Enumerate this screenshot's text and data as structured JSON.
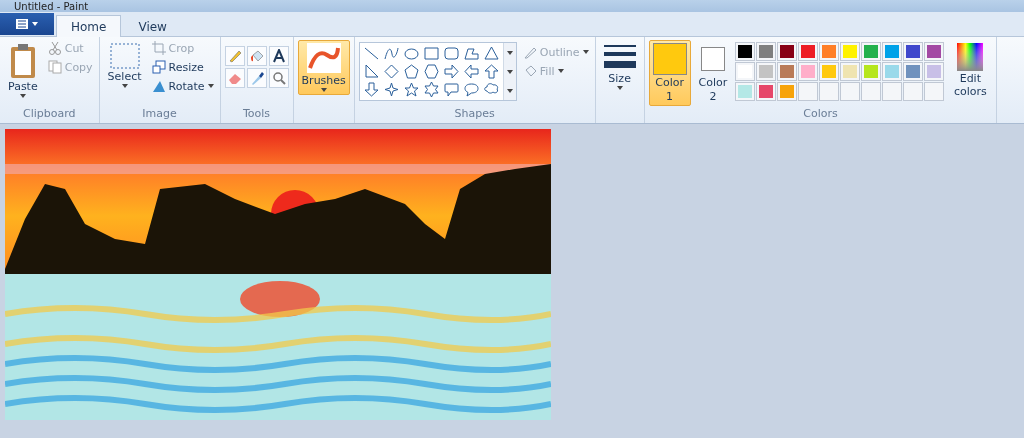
{
  "window": {
    "title": "Untitled - Paint"
  },
  "tabs": [
    {
      "label": "Home",
      "selected": true
    },
    {
      "label": "View",
      "selected": false
    }
  ],
  "clipboard": {
    "paste": "Paste",
    "cut": {
      "label": "Cut",
      "disabled": true
    },
    "copy": {
      "label": "Copy",
      "disabled": true
    },
    "group": "Clipboard"
  },
  "image": {
    "select": "Select",
    "crop": {
      "label": "Crop",
      "disabled": true
    },
    "resize": {
      "label": "Resize",
      "disabled": false
    },
    "rotate": {
      "label": "Rotate",
      "disabled": false
    },
    "group": "Image"
  },
  "tools": {
    "group": "Tools"
  },
  "brushes": {
    "label": "Brushes",
    "selected": true
  },
  "shapes": {
    "outline": {
      "label": "Outline",
      "disabled": true
    },
    "fill": {
      "label": "Fill",
      "disabled": true
    },
    "group": "Shapes"
  },
  "size": {
    "label": "Size"
  },
  "colors": {
    "color1": {
      "label": "Color",
      "number": "1",
      "color": "#ffc90e",
      "selected": true
    },
    "color2": {
      "label": "Color",
      "number": "2",
      "color": "#ffffff",
      "selected": false
    },
    "palette": [
      {
        "color": "#000000"
      },
      {
        "color": "#7f7f7f"
      },
      {
        "color": "#880015"
      },
      {
        "color": "#ed1c24"
      },
      {
        "color": "#ff7f27"
      },
      {
        "color": "#fff200"
      },
      {
        "color": "#22b14c"
      },
      {
        "color": "#00a2e8"
      },
      {
        "color": "#3f48cc"
      },
      {
        "color": "#a349a4"
      },
      {
        "color": "#ffffff"
      },
      {
        "color": "#c3c3c3"
      },
      {
        "color": "#b97a57"
      },
      {
        "color": "#ffaec9"
      },
      {
        "color": "#ffc90e"
      },
      {
        "color": "#efe4b0"
      },
      {
        "color": "#b5e61d"
      },
      {
        "color": "#99d9ea"
      },
      {
        "color": "#7092be"
      },
      {
        "color": "#c8bfe7"
      },
      {
        "color": "#b4e8e6"
      },
      {
        "color": "#e6476a"
      },
      {
        "color": "#f7a30a"
      }
    ],
    "edit": "Edit colors",
    "group": "Colors"
  }
}
